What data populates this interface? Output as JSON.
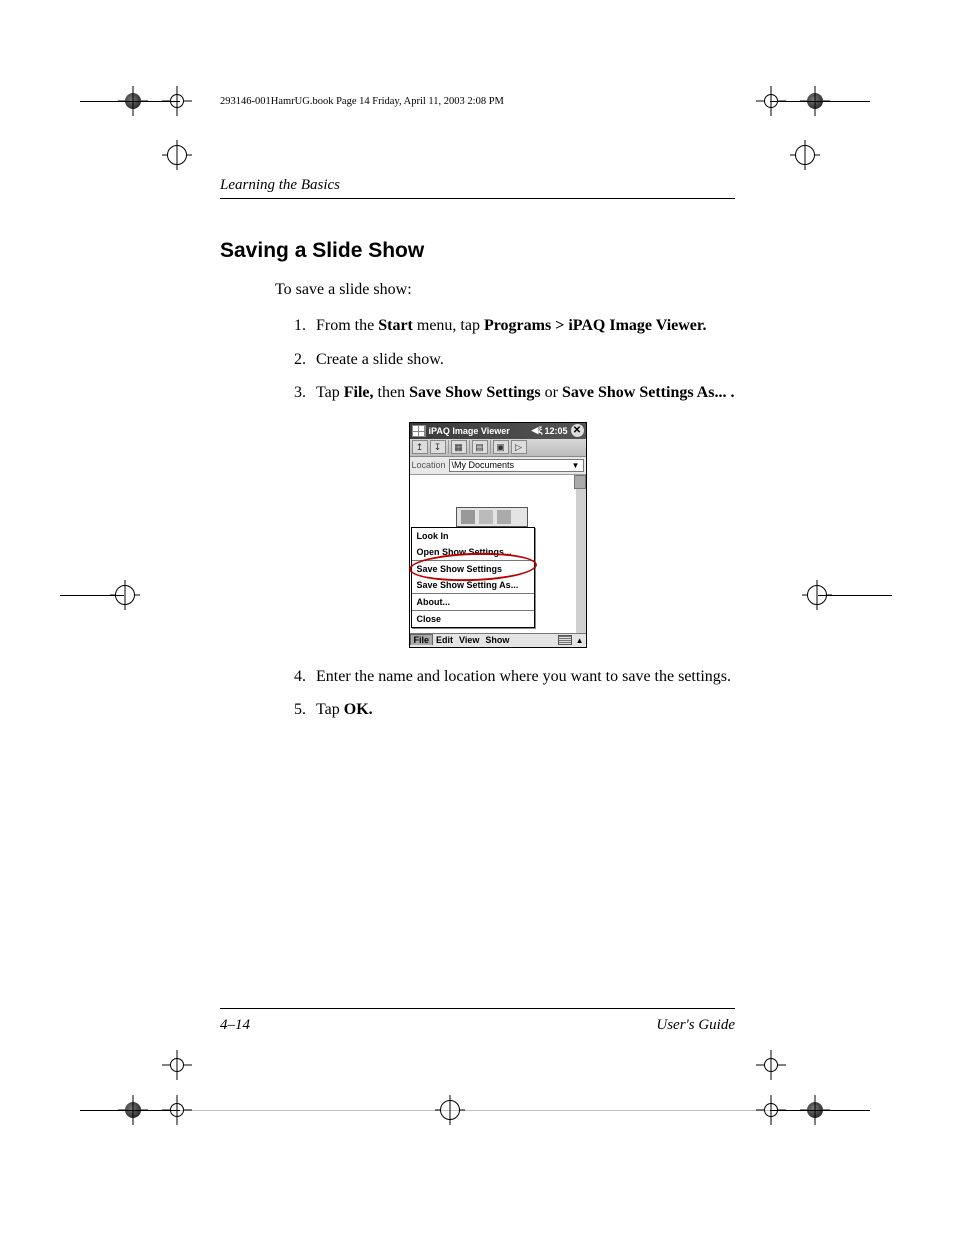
{
  "bookinfo": "293146-001HamrUG.book  Page 14  Friday, April 11, 2003  2:08 PM",
  "running_head": "Learning the Basics",
  "heading": "Saving a Slide Show",
  "intro": "To save a slide show:",
  "steps": {
    "s1_pre": "From the ",
    "s1_b1": "Start",
    "s1_mid": " menu, tap ",
    "s1_b2": "Programs > iPAQ Image Viewer.",
    "s2": "Create a slide show.",
    "s3_pre": "Tap ",
    "s3_b1": "File,",
    "s3_mid": " then ",
    "s3_b2": "Save Show Settings",
    "s3_mid2": " or ",
    "s3_b3": "Save Show Settings As... .",
    "s4": "Enter the name and location where you want to save the settings.",
    "s5_pre": "Tap ",
    "s5_b1": "OK."
  },
  "device": {
    "title": "iPAQ Image Viewer",
    "time": "12:05",
    "close": "✕",
    "location_label": "Location",
    "location_value": "\\My Documents",
    "menu": {
      "look_in": "Look In",
      "open_show": "Open Show Settings...",
      "save_show": "Save Show Settings",
      "save_show_as": "Save Show Setting As...",
      "about": "About...",
      "close": "Close"
    },
    "menubar": {
      "file": "File",
      "edit": "Edit",
      "view": "View",
      "show": "Show"
    }
  },
  "footer": {
    "page": "4–14",
    "guide": "User's Guide"
  }
}
